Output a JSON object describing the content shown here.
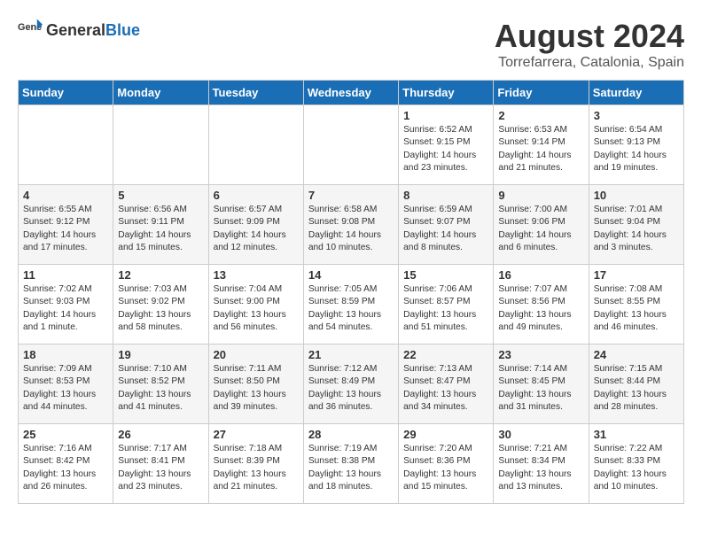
{
  "header": {
    "logo_general": "General",
    "logo_blue": "Blue",
    "title": "August 2024",
    "location": "Torrefarrera, Catalonia, Spain"
  },
  "days_of_week": [
    "Sunday",
    "Monday",
    "Tuesday",
    "Wednesday",
    "Thursday",
    "Friday",
    "Saturday"
  ],
  "weeks": [
    [
      {
        "day": "",
        "content": ""
      },
      {
        "day": "",
        "content": ""
      },
      {
        "day": "",
        "content": ""
      },
      {
        "day": "",
        "content": ""
      },
      {
        "day": "1",
        "content": "Sunrise: 6:52 AM\nSunset: 9:15 PM\nDaylight: 14 hours\nand 23 minutes."
      },
      {
        "day": "2",
        "content": "Sunrise: 6:53 AM\nSunset: 9:14 PM\nDaylight: 14 hours\nand 21 minutes."
      },
      {
        "day": "3",
        "content": "Sunrise: 6:54 AM\nSunset: 9:13 PM\nDaylight: 14 hours\nand 19 minutes."
      }
    ],
    [
      {
        "day": "4",
        "content": "Sunrise: 6:55 AM\nSunset: 9:12 PM\nDaylight: 14 hours\nand 17 minutes."
      },
      {
        "day": "5",
        "content": "Sunrise: 6:56 AM\nSunset: 9:11 PM\nDaylight: 14 hours\nand 15 minutes."
      },
      {
        "day": "6",
        "content": "Sunrise: 6:57 AM\nSunset: 9:09 PM\nDaylight: 14 hours\nand 12 minutes."
      },
      {
        "day": "7",
        "content": "Sunrise: 6:58 AM\nSunset: 9:08 PM\nDaylight: 14 hours\nand 10 minutes."
      },
      {
        "day": "8",
        "content": "Sunrise: 6:59 AM\nSunset: 9:07 PM\nDaylight: 14 hours\nand 8 minutes."
      },
      {
        "day": "9",
        "content": "Sunrise: 7:00 AM\nSunset: 9:06 PM\nDaylight: 14 hours\nand 6 minutes."
      },
      {
        "day": "10",
        "content": "Sunrise: 7:01 AM\nSunset: 9:04 PM\nDaylight: 14 hours\nand 3 minutes."
      }
    ],
    [
      {
        "day": "11",
        "content": "Sunrise: 7:02 AM\nSunset: 9:03 PM\nDaylight: 14 hours\nand 1 minute."
      },
      {
        "day": "12",
        "content": "Sunrise: 7:03 AM\nSunset: 9:02 PM\nDaylight: 13 hours\nand 58 minutes."
      },
      {
        "day": "13",
        "content": "Sunrise: 7:04 AM\nSunset: 9:00 PM\nDaylight: 13 hours\nand 56 minutes."
      },
      {
        "day": "14",
        "content": "Sunrise: 7:05 AM\nSunset: 8:59 PM\nDaylight: 13 hours\nand 54 minutes."
      },
      {
        "day": "15",
        "content": "Sunrise: 7:06 AM\nSunset: 8:57 PM\nDaylight: 13 hours\nand 51 minutes."
      },
      {
        "day": "16",
        "content": "Sunrise: 7:07 AM\nSunset: 8:56 PM\nDaylight: 13 hours\nand 49 minutes."
      },
      {
        "day": "17",
        "content": "Sunrise: 7:08 AM\nSunset: 8:55 PM\nDaylight: 13 hours\nand 46 minutes."
      }
    ],
    [
      {
        "day": "18",
        "content": "Sunrise: 7:09 AM\nSunset: 8:53 PM\nDaylight: 13 hours\nand 44 minutes."
      },
      {
        "day": "19",
        "content": "Sunrise: 7:10 AM\nSunset: 8:52 PM\nDaylight: 13 hours\nand 41 minutes."
      },
      {
        "day": "20",
        "content": "Sunrise: 7:11 AM\nSunset: 8:50 PM\nDaylight: 13 hours\nand 39 minutes."
      },
      {
        "day": "21",
        "content": "Sunrise: 7:12 AM\nSunset: 8:49 PM\nDaylight: 13 hours\nand 36 minutes."
      },
      {
        "day": "22",
        "content": "Sunrise: 7:13 AM\nSunset: 8:47 PM\nDaylight: 13 hours\nand 34 minutes."
      },
      {
        "day": "23",
        "content": "Sunrise: 7:14 AM\nSunset: 8:45 PM\nDaylight: 13 hours\nand 31 minutes."
      },
      {
        "day": "24",
        "content": "Sunrise: 7:15 AM\nSunset: 8:44 PM\nDaylight: 13 hours\nand 28 minutes."
      }
    ],
    [
      {
        "day": "25",
        "content": "Sunrise: 7:16 AM\nSunset: 8:42 PM\nDaylight: 13 hours\nand 26 minutes."
      },
      {
        "day": "26",
        "content": "Sunrise: 7:17 AM\nSunset: 8:41 PM\nDaylight: 13 hours\nand 23 minutes."
      },
      {
        "day": "27",
        "content": "Sunrise: 7:18 AM\nSunset: 8:39 PM\nDaylight: 13 hours\nand 21 minutes."
      },
      {
        "day": "28",
        "content": "Sunrise: 7:19 AM\nSunset: 8:38 PM\nDaylight: 13 hours\nand 18 minutes."
      },
      {
        "day": "29",
        "content": "Sunrise: 7:20 AM\nSunset: 8:36 PM\nDaylight: 13 hours\nand 15 minutes."
      },
      {
        "day": "30",
        "content": "Sunrise: 7:21 AM\nSunset: 8:34 PM\nDaylight: 13 hours\nand 13 minutes."
      },
      {
        "day": "31",
        "content": "Sunrise: 7:22 AM\nSunset: 8:33 PM\nDaylight: 13 hours\nand 10 minutes."
      }
    ]
  ]
}
